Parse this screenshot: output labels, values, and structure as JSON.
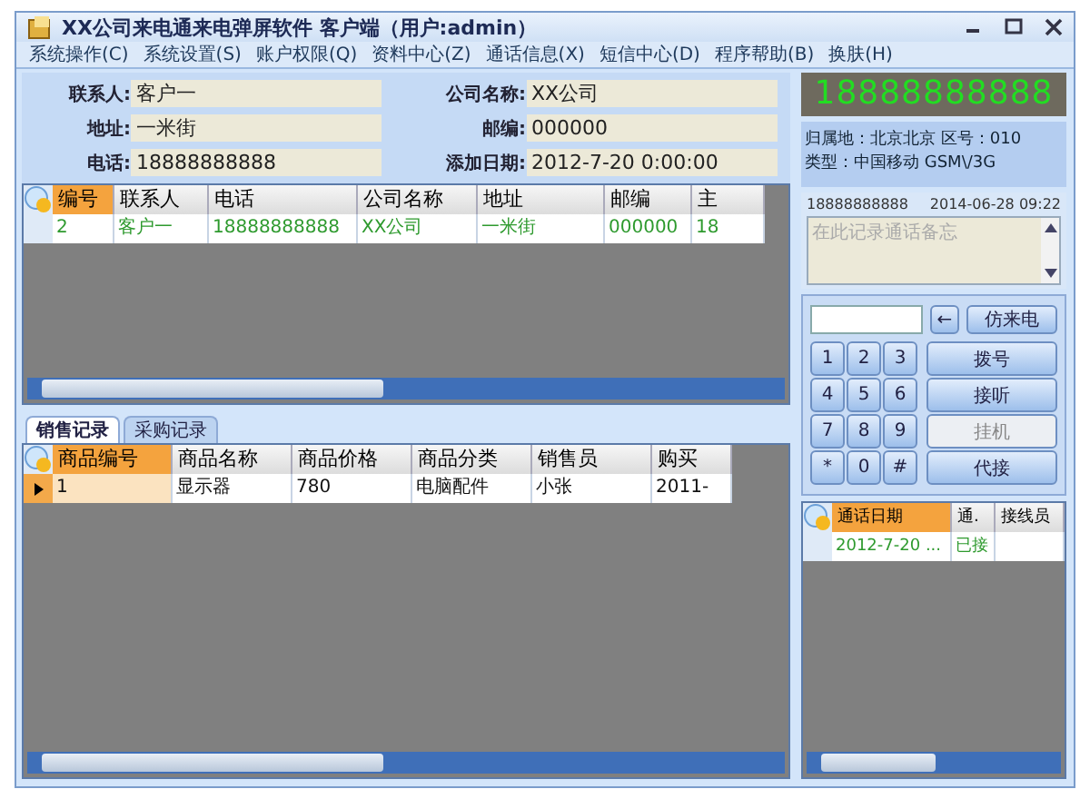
{
  "window": {
    "title": "XX公司来电通来电弹屏软件 客户端（用户:admin）"
  },
  "menu": {
    "items": [
      "系统操作(C)",
      "系统设置(S)",
      "账户权限(Q)",
      "资料中心(Z)",
      "通话信息(X)",
      "短信中心(D)",
      "程序帮助(B)"
    ],
    "right": "换肤(H)"
  },
  "customer_form": [
    {
      "label": "联系人:",
      "value": "客户一"
    },
    {
      "label": "公司名称:",
      "value": "XX公司"
    },
    {
      "label": "地址:",
      "value": "一米街"
    },
    {
      "label": "邮编:",
      "value": "000000"
    },
    {
      "label": "电话:",
      "value": "18888888888"
    },
    {
      "label": "添加日期:",
      "value": "2012-7-20 0:00:00"
    }
  ],
  "customer_table": {
    "columns": [
      {
        "label": "编号",
        "selected": true
      },
      {
        "label": "联系人",
        "selected": false
      },
      {
        "label": "电话",
        "selected": false
      },
      {
        "label": "公司名称",
        "selected": false
      },
      {
        "label": "地址",
        "selected": false
      },
      {
        "label": "邮编",
        "selected": false
      },
      {
        "label": "主",
        "selected": false
      }
    ],
    "rows": [
      [
        "2",
        "客户一",
        "18888888888",
        "XX公司",
        "一米街",
        "000000",
        "18"
      ]
    ]
  },
  "record_tabs": [
    {
      "label": "销售记录",
      "selected": true
    },
    {
      "label": "采购记录",
      "selected": false
    }
  ],
  "sales_table": {
    "columns": [
      {
        "label": "商品编号",
        "selected": true
      },
      {
        "label": "商品名称",
        "selected": false
      },
      {
        "label": "商品价格",
        "selected": false
      },
      {
        "label": "商品分类",
        "selected": false
      },
      {
        "label": "销售员",
        "selected": false
      },
      {
        "label": "购买",
        "selected": false
      }
    ],
    "rows": [
      [
        "1",
        "显示器",
        "780",
        "电脑配件",
        "小张",
        "2011-"
      ]
    ]
  },
  "phone_display": "18888888888",
  "caller_info": [
    "归属地：北京北京 区号：010",
    "类型：中国移动 GSM\\/3G"
  ],
  "note": {
    "number": "18888888888",
    "time": "2014-06-28 09:22",
    "placeholder": "在此记录通话备忘"
  },
  "dialer": {
    "back_key": "←",
    "fake_call_button": "仿来电",
    "keys": [
      "1",
      "2",
      "3",
      "4",
      "5",
      "6",
      "7",
      "8",
      "9",
      "*",
      "0",
      "#"
    ],
    "actions": [
      {
        "label": "拨号",
        "disabled": false
      },
      {
        "label": "接听",
        "disabled": false
      },
      {
        "label": "挂机",
        "disabled": true
      },
      {
        "label": "代接",
        "disabled": false
      }
    ]
  },
  "call_table": {
    "columns": [
      {
        "label": "通话日期",
        "selected": true
      },
      {
        "label": "通.",
        "selected": false
      },
      {
        "label": "接线员",
        "selected": false
      }
    ],
    "rows": [
      [
        "2012-7-20 ...",
        "已接",
        ""
      ]
    ]
  }
}
